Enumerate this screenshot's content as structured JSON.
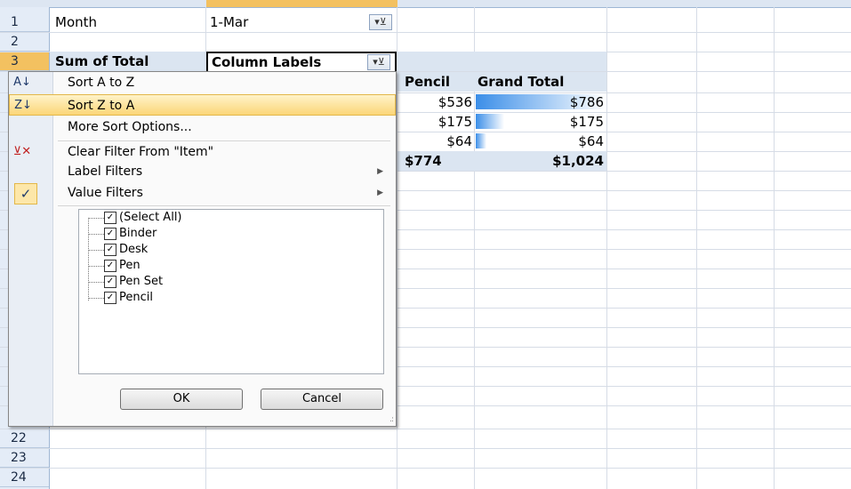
{
  "row_numbers_top": [
    "1",
    "2",
    "3"
  ],
  "row_numbers_bottom": [
    "22",
    "23",
    "24"
  ],
  "sheet": {
    "a1": "Month",
    "b1": "1-Mar",
    "a3": "Sum of Total",
    "b3": "Column Labels",
    "col_pencil": "Pencil",
    "col_grand_total": "Grand Total",
    "pencil_values": [
      "$536",
      "$175",
      "$64",
      "$774"
    ],
    "grand_total_values": [
      "$786",
      "$175",
      "$64",
      "$1,024"
    ],
    "grand_total_fill": [
      1.0,
      0.22,
      0.08
    ],
    "bar_color": "#3b8ee8"
  },
  "menu": {
    "sort_az": "Sort A to Z",
    "sort_za": "Sort Z to A",
    "more_sort": "More Sort Options...",
    "clear_filter": "Clear Filter From \"Item\"",
    "label_filters": "Label Filters",
    "value_filters": "Value Filters",
    "items": [
      "(Select All)",
      "Binder",
      "Desk",
      "Pen",
      "Pen Set",
      "Pencil"
    ],
    "ok": "OK",
    "cancel": "Cancel"
  },
  "icons": {
    "sort_az": "sort-ascending-icon",
    "sort_za": "sort-descending-icon",
    "clear_filter": "clear-filter-icon",
    "value_filters_check": "check-icon",
    "filter_dropdown": "filter-dropdown-icon"
  }
}
